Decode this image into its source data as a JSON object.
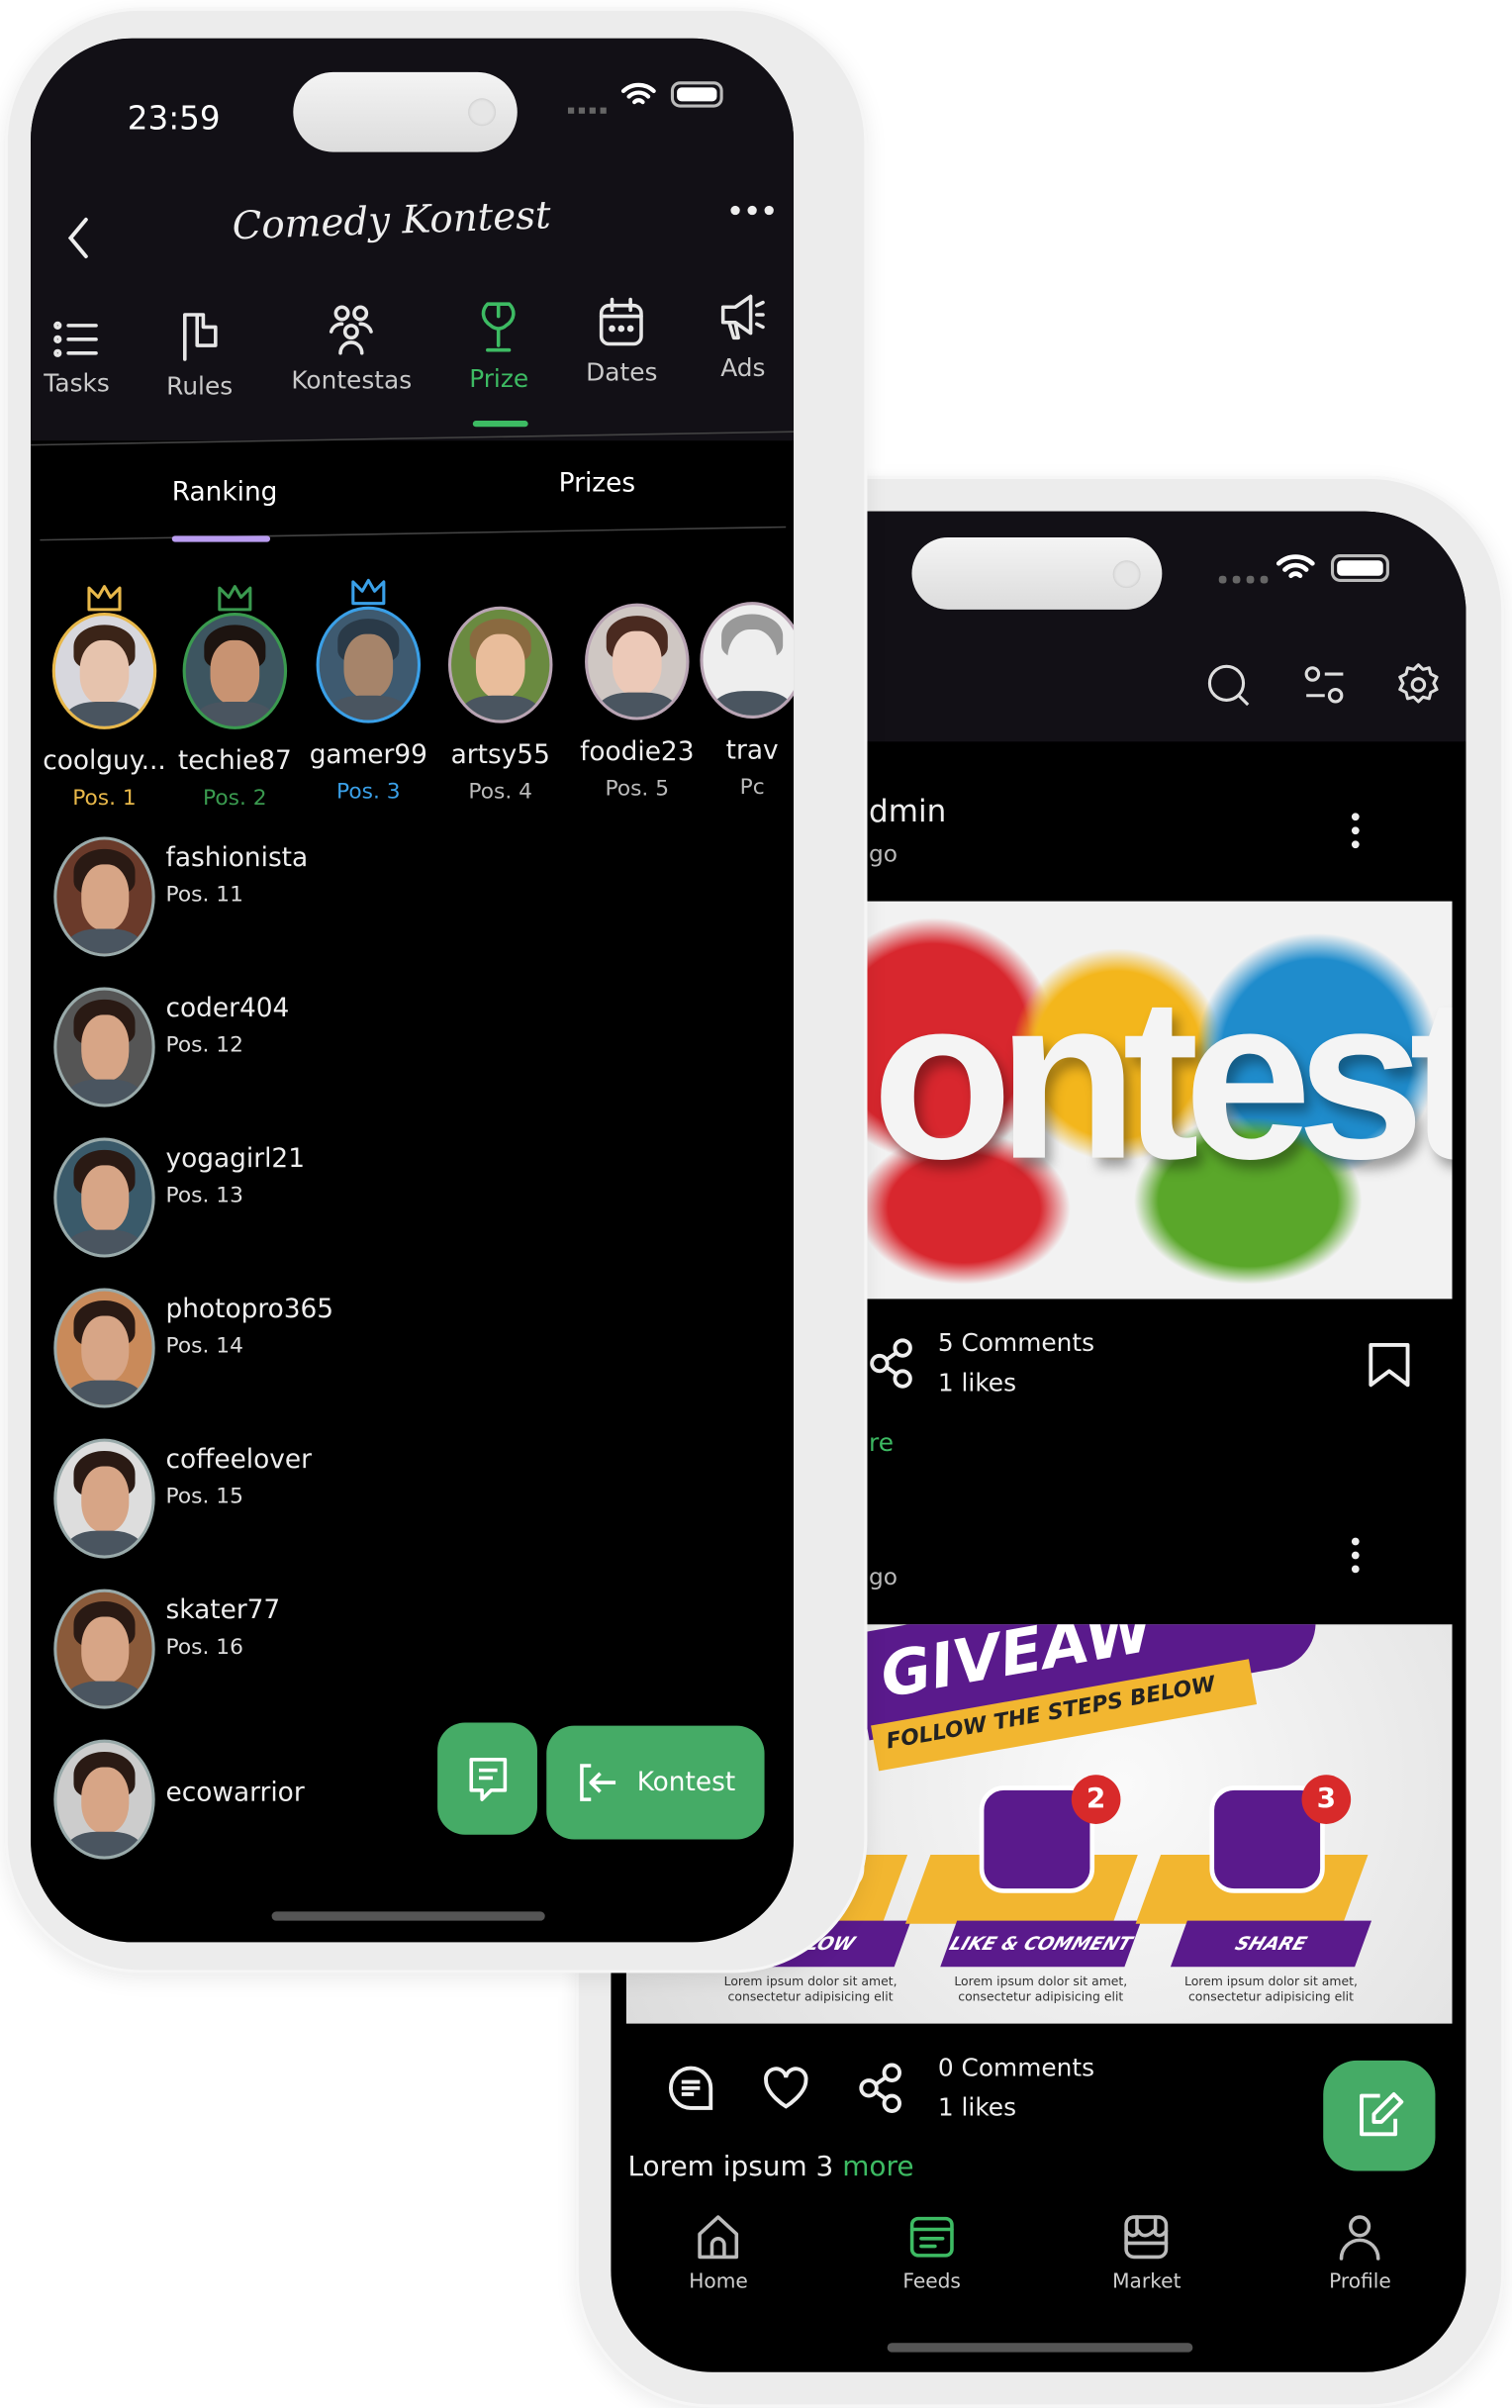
{
  "colors": {
    "accent": "#45ab66",
    "prize_green": "#3dbb63",
    "pos1": "#e8b84a",
    "pos2": "#3a9a4f",
    "pos3": "#3aa0e8",
    "ranking_indicator": "#b99cf0"
  },
  "left_phone": {
    "status": {
      "time": "23:59"
    },
    "header": {
      "title": "Comedy Kontest",
      "back_icon": "chevron-left-icon",
      "menu_icon": "more-horizontal-icon"
    },
    "tabs": [
      {
        "label": "Tasks",
        "icon": "list-icon"
      },
      {
        "label": "Rules",
        "icon": "flag-icon"
      },
      {
        "label": "Kontestas",
        "icon": "users-icon"
      },
      {
        "label": "Prize",
        "icon": "trophy-icon",
        "active": true
      },
      {
        "label": "Dates",
        "icon": "calendar-icon"
      },
      {
        "label": "Ads",
        "icon": "megaphone-icon"
      }
    ],
    "subtabs": [
      {
        "label": "Ranking",
        "active": true
      },
      {
        "label": "Prizes"
      }
    ],
    "top_ranked": [
      {
        "name": "coolguy...",
        "pos": "Pos. 1",
        "crown": true
      },
      {
        "name": "techie87",
        "pos": "Pos. 2",
        "crown": true
      },
      {
        "name": "gamer99",
        "pos": "Pos. 3",
        "crown": true
      },
      {
        "name": "artsy55",
        "pos": "Pos. 4"
      },
      {
        "name": "foodie23",
        "pos": "Pos. 5"
      },
      {
        "name": "trav",
        "pos": "Pc"
      }
    ],
    "ranking_list": [
      {
        "name": "fashionista",
        "pos": "Pos. 11"
      },
      {
        "name": "coder404",
        "pos": "Pos. 12"
      },
      {
        "name": "yogagirl21",
        "pos": "Pos. 13"
      },
      {
        "name": "photopro365",
        "pos": "Pos. 14"
      },
      {
        "name": "coffeelover",
        "pos": "Pos. 15"
      },
      {
        "name": "skater77",
        "pos": "Pos. 16"
      },
      {
        "name": "ecowarrior",
        "pos": ""
      }
    ],
    "chat_button_icon": "message-icon",
    "kontest_button": {
      "label": "Kontest",
      "icon": "exit-arrow-icon"
    }
  },
  "right_phone": {
    "header_icons": [
      "search-icon",
      "filter-icon",
      "gear-icon"
    ],
    "post1": {
      "author": "dmin",
      "time": "go",
      "image_text": "ontest",
      "comments": "5 Comments",
      "likes": "1 likes",
      "more": "re"
    },
    "post2": {
      "time": "go",
      "image": {
        "title": "GIVEAW",
        "subtitle": "FOLLOW THE STEPS BELOW",
        "steps": [
          {
            "label": "FOLLOW",
            "num": ""
          },
          {
            "label": "LIKE & COMMENT",
            "num": "2"
          },
          {
            "label": "SHARE",
            "num": "3"
          }
        ],
        "step_text": "Lorem ipsum dolor sit amet, consectetur adipisicing elit"
      },
      "comments": "0 Comments",
      "likes": "1 likes",
      "caption": "Lorem ipsum 3",
      "more": "more"
    },
    "bottom_nav": [
      {
        "label": "Home",
        "icon": "home-icon"
      },
      {
        "label": "Feeds",
        "icon": "feeds-icon",
        "active": true
      },
      {
        "label": "Market",
        "icon": "store-icon"
      },
      {
        "label": "Profile",
        "icon": "user-icon"
      }
    ]
  }
}
